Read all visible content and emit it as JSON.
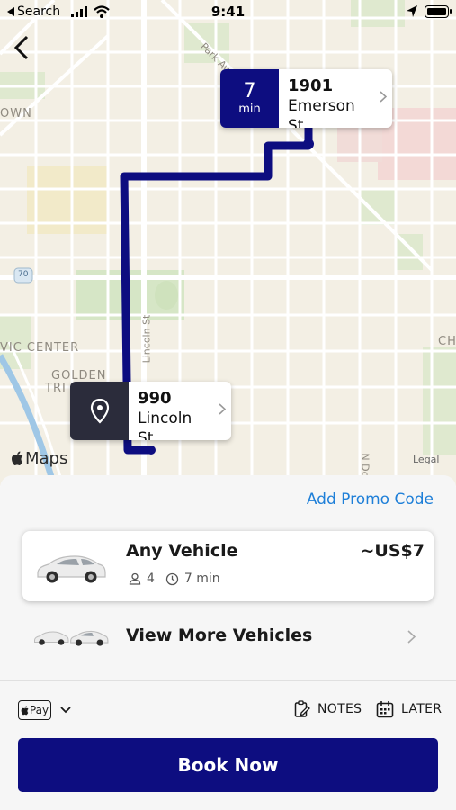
{
  "status_bar": {
    "back_app": "Search",
    "time": "9:41"
  },
  "map": {
    "labels": {
      "own": "OWN",
      "civic_center": "VIC CENTER",
      "golden": "GOLDEN",
      "tri": "TRI",
      "chi": "CH",
      "park_ave": "Park Ave",
      "lincoln_st": "Lincoln St",
      "n_dc": "N Dc",
      "route_70": "70"
    },
    "attribution": "Maps",
    "legal": "Legal"
  },
  "destination": {
    "eta_value": "7",
    "eta_unit": "min",
    "number": "1901",
    "street": "Emerson St"
  },
  "origin": {
    "number": "990",
    "street": "Lincoln St"
  },
  "sheet": {
    "promo_label": "Add Promo Code",
    "vehicle": {
      "name": "Any Vehicle",
      "price": "~US$7",
      "seats": "4",
      "eta": "7 min"
    },
    "more_vehicles_label": "View More Vehicles",
    "payment_label": "Pay",
    "notes_label": "NOTES",
    "later_label": "LATER",
    "book_label": "Book Now"
  },
  "colors": {
    "brand": "#0d0d80",
    "origin_badge": "#2b2c3b",
    "link": "#1e7fd8",
    "route": "#0d0d80"
  }
}
